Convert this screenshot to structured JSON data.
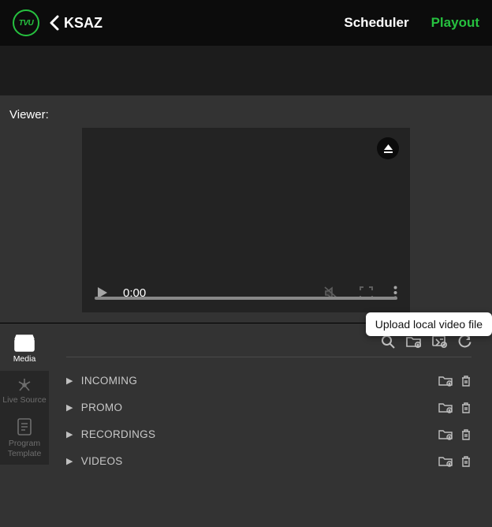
{
  "header": {
    "station": "KSAZ",
    "nav": {
      "scheduler": "Scheduler",
      "playout": "Playout"
    }
  },
  "viewer": {
    "label": "Viewer:",
    "time": "0:00"
  },
  "tooltip": "Upload local video file",
  "sidebar": {
    "media": "Media",
    "live": "Live Source",
    "template": "Program Template"
  },
  "folders": [
    {
      "name": "INCOMING"
    },
    {
      "name": "PROMO"
    },
    {
      "name": "RECORDINGS"
    },
    {
      "name": "VIDEOS"
    }
  ]
}
